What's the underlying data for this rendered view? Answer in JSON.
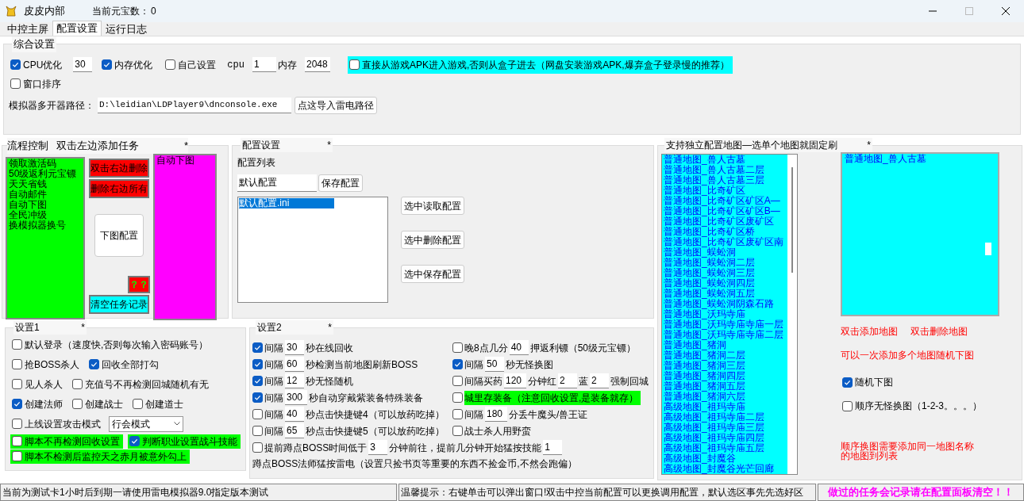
{
  "window": {
    "title": "皮皮内部",
    "coin_label": "当前元宝数：",
    "coin_value": "0"
  },
  "tabs": [
    {
      "label": "中控主屏",
      "selected": false
    },
    {
      "label": "配置设置",
      "selected": true
    },
    {
      "label": "运行日志",
      "selected": false
    }
  ],
  "general": {
    "title": "综合设置",
    "cpu_opt": {
      "label": "CPU优化",
      "checked": true,
      "value": "30"
    },
    "mem_opt": {
      "label": "内存优化",
      "checked": true
    },
    "custom": {
      "label": "自己设置",
      "checked": false,
      "cpu_label": "cpu",
      "cpu_value": "1",
      "mem_label": "内存",
      "mem_value": "2048"
    },
    "apk": {
      "label": "直接从游戏APK进入游戏,否则从盒子进去（网盘安装游戏APK,爆弃盒子登录慢的推荐）",
      "checked": false
    },
    "window_sort": {
      "label": "窗口排序",
      "checked": false
    },
    "path_label": "模拟器多开器路径：",
    "path_value": "D:\\leidian\\LDPlayer9\\dnconsole.exe",
    "import_button": "点这导入雷电路径"
  },
  "flow": {
    "title": "流程控制",
    "hint": "双击左边添加任务",
    "star": "*",
    "tasks": [
      "领取激活码",
      "50级返利元宝镖",
      "天天省钱",
      "自动邮件",
      "自动下图",
      "全民冲级",
      "换模拟器换号"
    ],
    "delete_dbl": "双击右边删除",
    "delete_all": "删除右边所有",
    "map_config": "下图配置",
    "help": "？？",
    "clear": "清空任务记录",
    "selected_tasks": [
      "自动下图"
    ]
  },
  "config": {
    "title": "配置设置",
    "star": "*",
    "list_label": "配置列表",
    "name_value": "默认配置",
    "save": "保存配置",
    "files": [
      {
        "name": "默认配置.ini",
        "selected": true
      }
    ],
    "buttons": [
      "选中读取配置",
      "选中删除配置",
      "选中保存配置"
    ]
  },
  "maps": {
    "title": "支持独立配置地图—选单个地图就固定刷",
    "star": "*",
    "available": [
      "普通地图_兽人古墓",
      "普通地图_兽人古墓二层",
      "普通地图_兽人古墓三层",
      "普通地图_比奇矿区",
      "普通地图_比奇矿区矿区A—",
      "普通地图_比奇矿区矿区B—",
      "普通地图_比奇矿区废矿区",
      "普通地图_比奇矿区桥",
      "普通地图_比奇矿区废矿区南",
      "普通地图_蜈蚣洞",
      "普通地图_蜈蚣洞二层",
      "普通地图_蜈蚣洞三层",
      "普通地图_蜈蚣洞四层",
      "普通地图_蜈蚣洞五层",
      "普通地图_蜈蚣洞阴森石路",
      "普通地图_沃玛寺庙",
      "普通地图_沃玛寺庙寺庙一层",
      "普通地图_沃玛寺庙寺庙二层",
      "普通地图_猪洞",
      "普通地图_猪洞二层",
      "普通地图_猪洞三层",
      "普通地图_猪洞四层",
      "普通地图_猪洞五层",
      "普通地图_猪洞六层",
      "高级地图_祖玛寺庙",
      "高级地图_祖玛寺庙二层",
      "高级地图_祖玛寺庙三层",
      "高级地图_祖玛寺庙四层",
      "高级地图_祖玛寺庙五层",
      "高级地图_封魔谷",
      "高级地图_封魔谷光芒回廊"
    ],
    "chosen": [
      "普通地图_兽人古墓"
    ],
    "hint_add": "双击添加地图",
    "hint_del": "双击删除地图",
    "hint_multi": "可以一次添加多个地图随机下图",
    "random": {
      "label": "随机下图",
      "checked": true
    },
    "sequential": {
      "label": "顺序无怪换图（1-2-3。。。）",
      "checked": false
    },
    "note": "顺序换图需要添加同一地图名称的地图到列表"
  },
  "settings1": {
    "title": "设置1",
    "star": "*",
    "rows": [
      [
        {
          "kind": "checkbox",
          "label": "默认登录（速度快,否则每次输入密码账号）",
          "checked": false,
          "highlighted": false
        }
      ],
      [
        {
          "kind": "checkbox",
          "label": "抢BOSS杀人",
          "checked": false,
          "highlighted": false
        },
        {
          "kind": "checkbox",
          "label": "回收全部打勾",
          "checked": true,
          "highlighted": false
        }
      ],
      [
        {
          "kind": "checkbox",
          "label": "见人杀人",
          "checked": false,
          "highlighted": false
        },
        {
          "kind": "checkbox",
          "label": "充值号不再检测回城随机有无",
          "checked": false,
          "highlighted": false
        }
      ],
      [
        {
          "kind": "checkbox",
          "label": "创建法师",
          "checked": true,
          "highlighted": false
        },
        {
          "kind": "checkbox",
          "label": "创建战士",
          "checked": false,
          "highlighted": false
        },
        {
          "kind": "checkbox",
          "label": "创建道士",
          "checked": false,
          "highlighted": false
        }
      ],
      [
        {
          "kind": "checkbox",
          "label": "上线设置攻击模式",
          "checked": false,
          "highlighted": false
        },
        {
          "kind": "select",
          "value": "行会模式"
        }
      ],
      [
        {
          "kind": "checkbox",
          "label": "脚本不再检测回收设置",
          "checked": false,
          "highlighted": true
        },
        {
          "kind": "checkbox",
          "label": "判断职业设置战斗技能",
          "checked": true,
          "highlighted": true
        }
      ],
      [
        {
          "kind": "checkbox",
          "label": "脚本不检测后监控天之赤月被意外勾上",
          "checked": false,
          "highlighted": true
        }
      ]
    ]
  },
  "settings2": {
    "title": "设置2",
    "star": "*",
    "left": [
      {
        "checked": true,
        "highlighted": false,
        "parts": [
          {
            "kind": "text",
            "text": "间隔"
          },
          {
            "kind": "input",
            "value": "30"
          },
          {
            "kind": "text",
            "text": "秒在线回收"
          }
        ]
      },
      {
        "checked": true,
        "highlighted": false,
        "parts": [
          {
            "kind": "text",
            "text": "间隔"
          },
          {
            "kind": "input",
            "value": "60"
          },
          {
            "kind": "text",
            "text": "秒检测当前地图刷新BOSS"
          }
        ]
      },
      {
        "checked": true,
        "highlighted": false,
        "parts": [
          {
            "kind": "text",
            "text": "间隔"
          },
          {
            "kind": "input",
            "value": "12"
          },
          {
            "kind": "text",
            "text": "秒无怪随机"
          }
        ]
      },
      {
        "checked": true,
        "highlighted": false,
        "parts": [
          {
            "kind": "text",
            "text": "间隔"
          },
          {
            "kind": "input",
            "value": "300"
          },
          {
            "kind": "text",
            "text": "秒自动穿戴紫装备特殊装备"
          }
        ]
      },
      {
        "checked": false,
        "highlighted": false,
        "parts": [
          {
            "kind": "text",
            "text": "间隔"
          },
          {
            "kind": "input",
            "value": "40"
          },
          {
            "kind": "text",
            "text": "秒点击快捷键4（可以放药吃掉）"
          }
        ]
      },
      {
        "checked": false,
        "highlighted": false,
        "parts": [
          {
            "kind": "text",
            "text": "间隔"
          },
          {
            "kind": "input",
            "value": "65"
          },
          {
            "kind": "text",
            "text": "秒点击快捷键5（可以放药吃掉）"
          }
        ]
      }
    ],
    "right": [
      {
        "checked": false,
        "highlighted": false,
        "parts": [
          {
            "kind": "text",
            "text": "晚8点几分"
          },
          {
            "kind": "input",
            "value": "40"
          },
          {
            "kind": "text",
            "text": "押返利镖（50级元宝镖）"
          }
        ]
      },
      {
        "checked": true,
        "highlighted": false,
        "parts": [
          {
            "kind": "text",
            "text": "间隔"
          },
          {
            "kind": "input",
            "value": "50"
          },
          {
            "kind": "text",
            "text": "秒无怪换图"
          }
        ]
      },
      {
        "checked": false,
        "highlighted": false,
        "parts": [
          {
            "kind": "text",
            "text": "间隔买药"
          },
          {
            "kind": "input",
            "value": "120"
          },
          {
            "kind": "text",
            "text": "分钟红"
          },
          {
            "kind": "input",
            "value": "2"
          },
          {
            "kind": "text",
            "text": "蓝"
          },
          {
            "kind": "input",
            "value": "2"
          },
          {
            "kind": "text",
            "text": "强制回城"
          }
        ]
      },
      {
        "checked": false,
        "highlighted": true,
        "parts": [
          {
            "kind": "text",
            "text": "城里存装备（注意回收设置,是装备就存）"
          }
        ]
      },
      {
        "checked": false,
        "highlighted": false,
        "parts": [
          {
            "kind": "text",
            "text": "间隔"
          },
          {
            "kind": "input",
            "value": "180"
          },
          {
            "kind": "text",
            "text": "分丢牛魔头/兽王证"
          }
        ]
      },
      {
        "checked": false,
        "highlighted": false,
        "parts": [
          {
            "kind": "text",
            "text": "战士杀人用野蛮"
          }
        ]
      }
    ],
    "full": {
      "checked": false,
      "highlighted": false,
      "parts": [
        {
          "kind": "text",
          "text": "提前蹲点BOSS时间低于"
        },
        {
          "kind": "input",
          "value": "3"
        },
        {
          "kind": "text",
          "text": "分钟前往，提前几分钟开始猛按技能"
        },
        {
          "kind": "input",
          "value": "1"
        }
      ]
    },
    "note": "蹲点BOSS法师猛按雷电（设置只捡书页等重要的东西不捡金币,不然会跑偏）"
  },
  "status_bar": [
    {
      "text": "当前为测试卡1小时后到期一请使用雷电模拟器9.0指定版本测试",
      "color": "#000000"
    },
    {
      "text": "温馨提示：右键单击可以弹出窗口!双击中控当前配置可以更换调用配置，默认选区事先先选好区",
      "color": "#000000"
    },
    {
      "text": "做过的任务会记录请在配置面板清空！！",
      "color": "#ff00ff"
    }
  ]
}
